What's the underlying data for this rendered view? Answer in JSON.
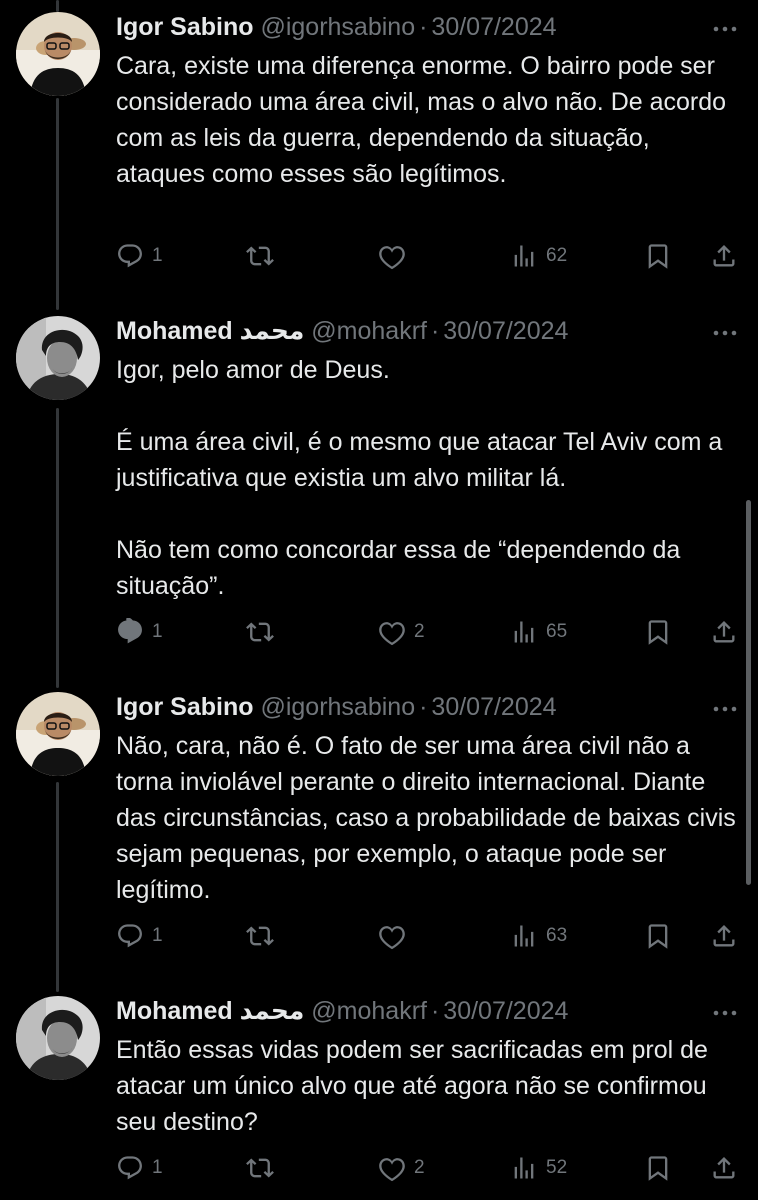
{
  "tweets": [
    {
      "name": "Igor Sabino",
      "handle": "@igorhsabino",
      "sep": "·",
      "date": "30/07/2024",
      "paragraphs": [
        "Cara, existe uma diferença enorme. O bairro pode ser considerado uma área civil, mas o alvo não. De acordo com as leis da guerra, dependendo da situação, ataques como esses são legítimos."
      ],
      "replies": "1",
      "retweets": "",
      "likes": "",
      "views": "62"
    },
    {
      "name": "Mohamed محمد",
      "handle": "@mohakrf",
      "sep": "·",
      "date": "30/07/2024",
      "paragraphs": [
        "Igor, pelo amor de Deus.",
        "É uma área civil, é o mesmo que atacar Tel Aviv com a justificativa que existia um alvo militar lá.",
        "Não tem como concordar essa de “dependendo da situação”."
      ],
      "replies": "1",
      "retweets": "",
      "likes": "2",
      "views": "65"
    },
    {
      "name": "Igor Sabino",
      "handle": "@igorhsabino",
      "sep": "·",
      "date": "30/07/2024",
      "paragraphs": [
        "Não, cara, não é. O fato de ser uma área civil não a torna inviolável perante o direito internacional. Diante das circunstâncias, caso a probabilidade de baixas civis sejam pequenas, por exemplo, o ataque pode ser legítimo."
      ],
      "replies": "1",
      "retweets": "",
      "likes": "",
      "views": "63"
    },
    {
      "name": "Mohamed محمد",
      "handle": "@mohakrf",
      "sep": "·",
      "date": "30/07/2024",
      "paragraphs": [
        "Então essas vidas podem ser sacrificadas em prol de atacar um único alvo que até agora não se confirmou seu destino?"
      ],
      "replies": "1",
      "retweets": "",
      "likes": "2",
      "views": "52"
    }
  ],
  "icons": {
    "reply": "reply-icon",
    "retweet": "retweet-icon",
    "like": "heart-icon",
    "views": "views-icon",
    "bookmark": "bookmark-icon",
    "share": "share-icon",
    "more": "more-icon"
  },
  "colors": {
    "background": "#000000",
    "text": "#e7e9ea",
    "secondary": "#71767b",
    "thread_line": "#333639"
  }
}
